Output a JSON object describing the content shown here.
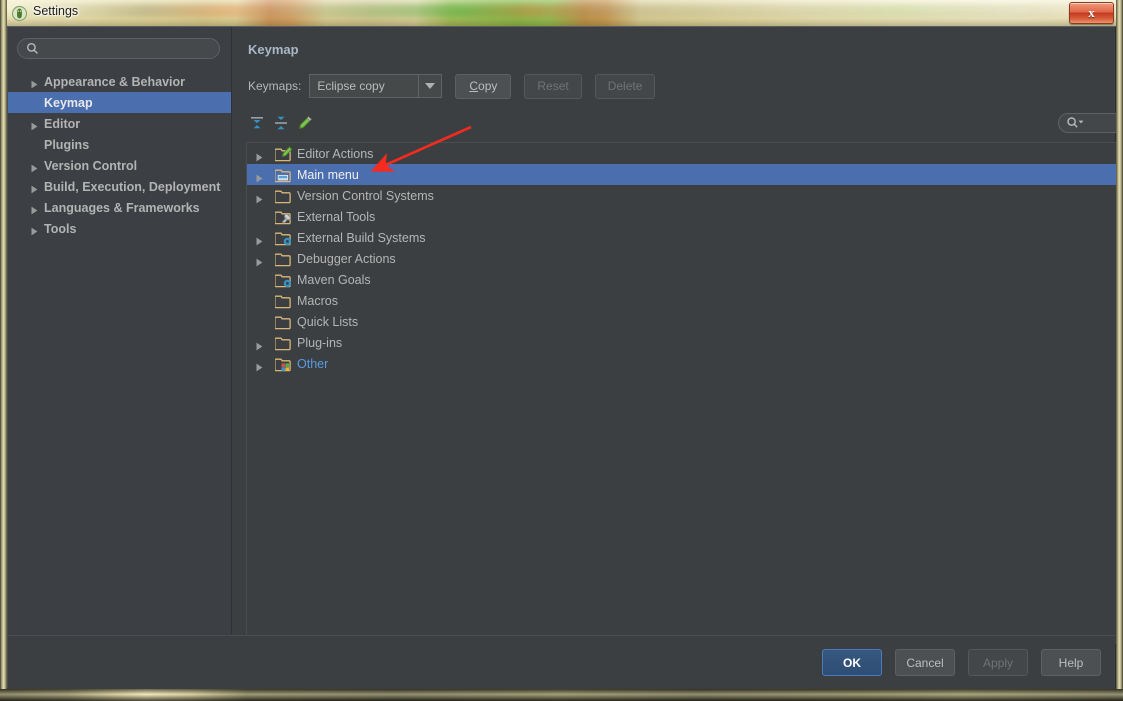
{
  "window": {
    "title": "Settings",
    "app_icon": "android-studio-icon",
    "close_label": "x"
  },
  "sidebar": {
    "search": {
      "value": "",
      "placeholder": "",
      "icon": "search-icon"
    },
    "items": [
      {
        "label": "Appearance & Behavior",
        "expandable": true,
        "selected": false
      },
      {
        "label": "Keymap",
        "expandable": false,
        "selected": true
      },
      {
        "label": "Editor",
        "expandable": true,
        "selected": false
      },
      {
        "label": "Plugins",
        "expandable": false,
        "selected": false
      },
      {
        "label": "Version Control",
        "expandable": true,
        "selected": false
      },
      {
        "label": "Build, Execution, Deployment",
        "expandable": true,
        "selected": false
      },
      {
        "label": "Languages & Frameworks",
        "expandable": true,
        "selected": false
      },
      {
        "label": "Tools",
        "expandable": true,
        "selected": false
      }
    ]
  },
  "content": {
    "title": "Keymap",
    "keymaps_label": "Keymaps:",
    "keymap_selected": "Eclipse copy",
    "buttons": {
      "copy": "Copy",
      "copy_mnemonic": "C",
      "copy_rest": "opy",
      "reset": "Reset",
      "delete": "Delete"
    },
    "toolbar_icons": [
      {
        "name": "expand-all-icon"
      },
      {
        "name": "collapse-all-icon"
      },
      {
        "name": "edit-shortcut-icon"
      }
    ],
    "search": {
      "value": "",
      "placeholder": "",
      "icon": "search-dropdown-icon"
    },
    "right_icons": [
      {
        "name": "find-by-shortcut-icon"
      },
      {
        "name": "delete-shortcut-icon"
      }
    ],
    "tree": [
      {
        "label": "Editor Actions",
        "expandable": true,
        "icon": "folder-edit-icon",
        "selected": false,
        "link": false
      },
      {
        "label": "Main menu",
        "expandable": true,
        "icon": "folder-menu-icon",
        "selected": true,
        "link": false
      },
      {
        "label": "Version Control Systems",
        "expandable": true,
        "icon": "folder-icon",
        "selected": false,
        "link": false
      },
      {
        "label": "External Tools",
        "expandable": false,
        "icon": "folder-tools-icon",
        "selected": false,
        "link": false
      },
      {
        "label": "External Build Systems",
        "expandable": true,
        "icon": "folder-gear-icon",
        "selected": false,
        "link": false
      },
      {
        "label": "Debugger Actions",
        "expandable": true,
        "icon": "folder-icon",
        "selected": false,
        "link": false
      },
      {
        "label": "Maven Goals",
        "expandable": false,
        "icon": "folder-gear-icon",
        "selected": false,
        "link": false
      },
      {
        "label": "Macros",
        "expandable": false,
        "icon": "folder-icon",
        "selected": false,
        "link": false
      },
      {
        "label": "Quick Lists",
        "expandable": false,
        "icon": "folder-icon",
        "selected": false,
        "link": false
      },
      {
        "label": "Plug-ins",
        "expandable": true,
        "icon": "folder-icon",
        "selected": false,
        "link": false
      },
      {
        "label": "Other",
        "expandable": true,
        "icon": "folder-plugin-icon",
        "selected": false,
        "link": true
      }
    ]
  },
  "footer": {
    "ok": "OK",
    "cancel": "Cancel",
    "apply": "Apply",
    "help": "Help"
  },
  "annotation": {
    "type": "red-arrow",
    "color": "#f52b1f",
    "points_to": "Main menu"
  },
  "colors": {
    "selection": "#4b6eaf",
    "panel_bg": "#3c3f41",
    "sidebar_bg": "#3c4044",
    "link": "#5a9ae0",
    "accent_ok": "#365880",
    "folder": "#d9b778",
    "annotation": "#f52b1f"
  }
}
